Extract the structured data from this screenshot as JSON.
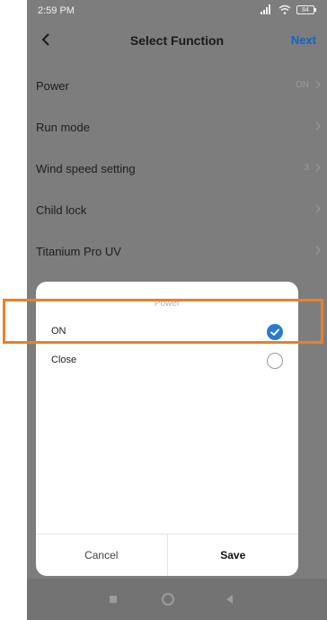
{
  "status_bar": {
    "time": "2:59 PM",
    "battery": "84"
  },
  "header": {
    "title": "Select Function",
    "next_label": "Next"
  },
  "functions": [
    {
      "label": "Power",
      "value": "ON"
    },
    {
      "label": "Run mode",
      "value": ""
    },
    {
      "label": "Wind speed setting",
      "value": "3"
    },
    {
      "label": "Child lock",
      "value": ""
    },
    {
      "label": "Titanium Pro UV",
      "value": ""
    }
  ],
  "dialog": {
    "title": "Power",
    "options": [
      {
        "label": "ON",
        "selected": true
      },
      {
        "label": "Close",
        "selected": false
      }
    ],
    "cancel_label": "Cancel",
    "save_label": "Save"
  },
  "colors": {
    "accent": "#2a7ad5",
    "next": "#1565c0",
    "highlight": "#e7812a"
  },
  "icons": [
    "back-arrow-icon",
    "chevron-right-icon",
    "checkmark-icon",
    "signal-icon",
    "wifi-icon",
    "battery-icon"
  ]
}
